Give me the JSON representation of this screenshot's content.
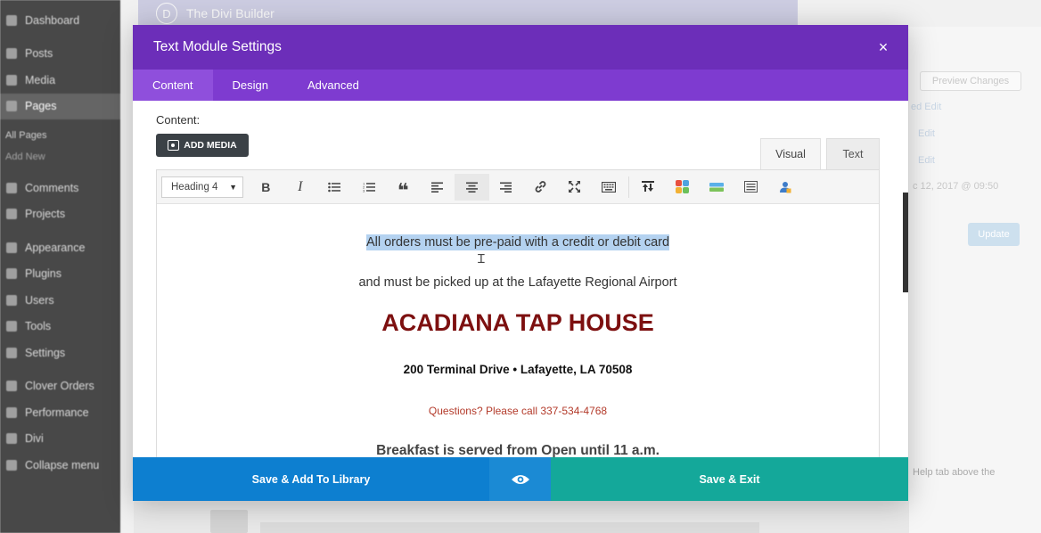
{
  "wp_menu": {
    "items": [
      {
        "label": "Dashboard"
      },
      {
        "label": "Posts"
      },
      {
        "label": "Media"
      },
      {
        "label": "Pages"
      }
    ],
    "pages_sub": [
      {
        "label": "All Pages"
      },
      {
        "label": "Add New"
      }
    ],
    "items2": [
      {
        "label": "Comments"
      },
      {
        "label": "Projects"
      },
      {
        "label": "Appearance"
      },
      {
        "label": "Plugins"
      },
      {
        "label": "Users"
      },
      {
        "label": "Tools"
      },
      {
        "label": "Settings"
      },
      {
        "label": "Clover Orders"
      },
      {
        "label": "Performance"
      },
      {
        "label": "Divi"
      },
      {
        "label": "Collapse menu"
      }
    ]
  },
  "background": {
    "builder_title": "The Divi Builder",
    "builder_logo": "D",
    "preview_changes": "Preview Changes",
    "update": "Update",
    "edit1": "ed Edit",
    "edit2": "Edit",
    "edit3": "Edit",
    "date": "c 12, 2017 @ 09:50",
    "help": "Help tab above the"
  },
  "modal": {
    "title": "Text Module Settings",
    "close_icon": "×",
    "tabs": [
      {
        "label": "Content"
      },
      {
        "label": "Design"
      },
      {
        "label": "Advanced"
      }
    ],
    "content_label": "Content:",
    "add_media": "ADD MEDIA",
    "editor_tabs": {
      "visual": "Visual",
      "text": "Text"
    },
    "format_select": "Heading 4",
    "content": {
      "line1": "All orders must be pre-paid with a credit or debit card",
      "line2": "and must be picked up at the Lafayette Regional Airport",
      "line3": "ACADIANA TAP HOUSE",
      "line4": "200 Terminal Drive • Lafayette, LA 70508",
      "line5": "Questions? Please call 337-534-4768",
      "line6": "Breakfast is served from Open until 11 a.m."
    },
    "footer": {
      "save_library": "Save & Add To Library",
      "save_exit": "Save & Exit"
    }
  },
  "colors": {
    "header": "#6c2eb9",
    "tabs": "#7e3bd0",
    "library_button": "#0d7fd0",
    "exit_button": "#14a89a",
    "heading_red": "#7d1010",
    "phone_red": "#b33a2a"
  }
}
